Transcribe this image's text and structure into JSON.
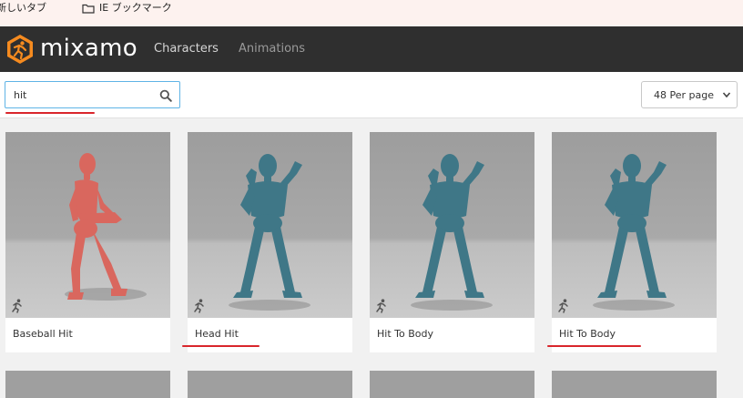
{
  "bookmarks": [
    {
      "label": "新しいタブ",
      "icon": "doc-icon"
    },
    {
      "label": "IE ブックマーク",
      "icon": "folder-icon"
    }
  ],
  "nav": {
    "logo_text": "mixamo",
    "links": [
      "Characters",
      "Animations"
    ]
  },
  "search": {
    "value": "hit",
    "placeholder": ""
  },
  "per_page": {
    "selected": "48 Per page"
  },
  "cards": [
    {
      "label": "Baseball Hit",
      "figure_color": "#d9675e"
    },
    {
      "label": "Head Hit",
      "figure_color": "#3f7787"
    },
    {
      "label": "Hit To Body",
      "figure_color": "#3f7787"
    },
    {
      "label": "Hit To Body",
      "figure_color": "#3f7787"
    }
  ],
  "colors": {
    "accent_orange": "#f68b1f",
    "annotation_red": "#d9262c",
    "nav_bg": "#2f2f2f"
  }
}
